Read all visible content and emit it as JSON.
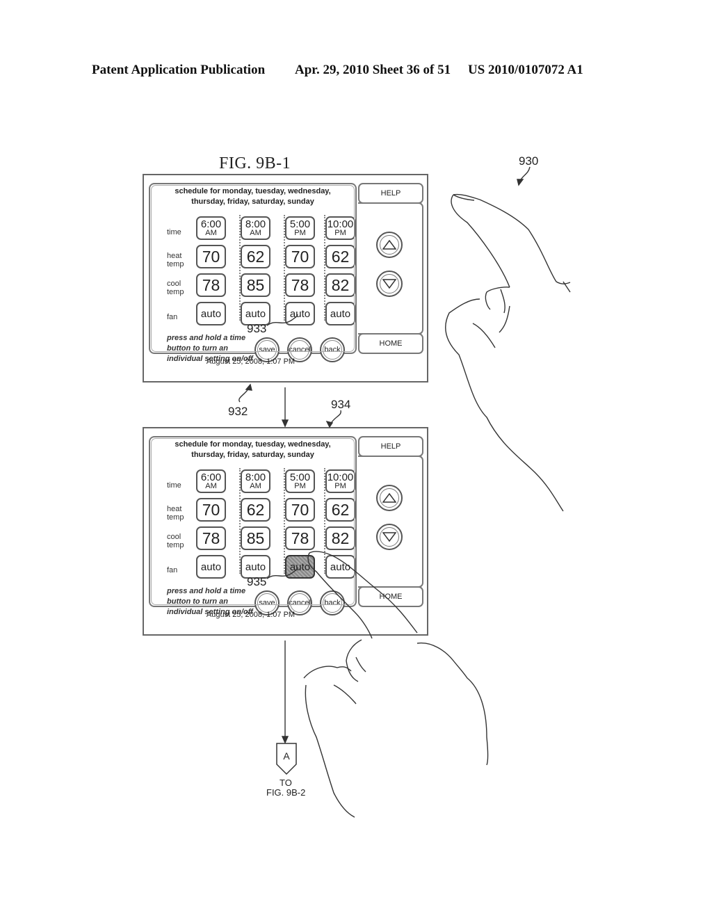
{
  "header": {
    "publication": "Patent Application Publication",
    "date_sheet": "Apr. 29, 2010  Sheet 36 of 51",
    "pub_number": "US 2010/0107072 A1"
  },
  "figure": {
    "title": "FIG. 9B-1",
    "ref_overall": "930",
    "ref_screen_1": "932",
    "ref_screen_2": "934",
    "ref_callout_1": "933",
    "ref_callout_2": "935",
    "offpage_connector": {
      "letter": "A",
      "to_label": "TO",
      "fig_label": "FIG. 9B-2"
    }
  },
  "screens": [
    {
      "schedule_line1": "schedule for monday, tuesday, wednesday,",
      "schedule_line2": "thursday, friday, saturday, sunday",
      "row_labels": {
        "time": "time",
        "heat_1": "heat",
        "heat_2": "temp",
        "cool_1": "cool",
        "cool_2": "temp",
        "fan": "fan"
      },
      "periods": [
        {
          "time": "6:00",
          "ampm": "AM",
          "heat": "70",
          "cool": "78",
          "fan": "auto"
        },
        {
          "time": "8:00",
          "ampm": "AM",
          "heat": "62",
          "cool": "85",
          "fan": "auto"
        },
        {
          "time": "5:00",
          "ampm": "PM",
          "heat": "70",
          "cool": "78",
          "fan": "auto"
        },
        {
          "time": "10:00",
          "ampm": "PM",
          "heat": "62",
          "cool": "82",
          "fan": "auto"
        }
      ],
      "note_1": "press and hold a time",
      "note_2": "button to turn an",
      "note_3": "individual setting on/off",
      "buttons": {
        "save": "save",
        "cancel": "cancel",
        "back": "back"
      },
      "help": "HELP",
      "home": "HOME",
      "datetime": "August 25, 2008, 1:07 PM",
      "pressed_fan_period": null
    },
    {
      "schedule_line1": "schedule for monday, tuesday, wednesday,",
      "schedule_line2": "thursday, friday, saturday, sunday",
      "row_labels": {
        "time": "time",
        "heat_1": "heat",
        "heat_2": "temp",
        "cool_1": "cool",
        "cool_2": "temp",
        "fan": "fan"
      },
      "periods": [
        {
          "time": "6:00",
          "ampm": "AM",
          "heat": "70",
          "cool": "78",
          "fan": "auto"
        },
        {
          "time": "8:00",
          "ampm": "AM",
          "heat": "62",
          "cool": "85",
          "fan": "auto"
        },
        {
          "time": "5:00",
          "ampm": "PM",
          "heat": "70",
          "cool": "78",
          "fan": "auto"
        },
        {
          "time": "10:00",
          "ampm": "PM",
          "heat": "62",
          "cool": "82",
          "fan": "auto"
        }
      ],
      "note_1": "press and hold a time",
      "note_2": "button to turn an",
      "note_3": "individual setting on/off",
      "buttons": {
        "save": "save",
        "cancel": "cancel",
        "back": "back"
      },
      "help": "HELP",
      "home": "HOME",
      "datetime": "August 25, 2008, 1:07 PM",
      "pressed_fan_period": 3
    }
  ]
}
